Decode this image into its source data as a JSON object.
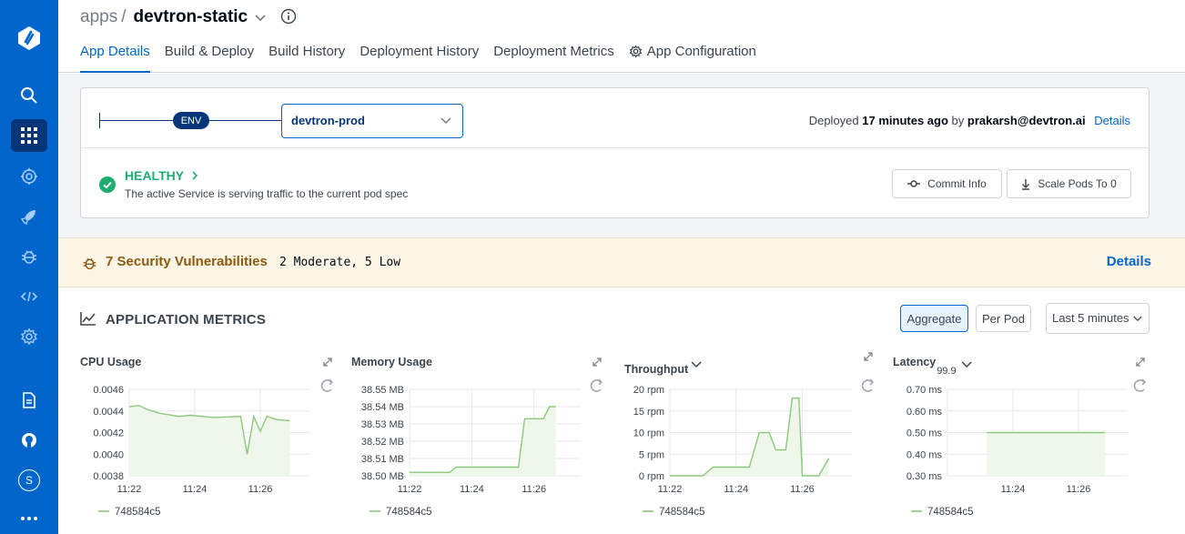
{
  "breadcrumb": {
    "root": "apps",
    "separator": "/",
    "app_name": "devtron-static"
  },
  "tabs": [
    {
      "label": "App Details",
      "active": true
    },
    {
      "label": "Build & Deploy"
    },
    {
      "label": "Build History"
    },
    {
      "label": "Deployment History"
    },
    {
      "label": "Deployment Metrics"
    },
    {
      "label": "App Configuration",
      "icon": "gear-icon"
    }
  ],
  "environment": {
    "pill": "ENV",
    "selected": "devtron-prod"
  },
  "deployment": {
    "prefix": "Deployed",
    "time": "17 minutes ago",
    "by": "by",
    "user": "prakarsh@devtron.ai",
    "details_link": "Details"
  },
  "health": {
    "status": "HEALTHY",
    "description": "The active Service is serving traffic to the current pod spec"
  },
  "actions": {
    "commit_info": "Commit Info",
    "scale_pods": "Scale Pods To 0"
  },
  "security": {
    "title": "7 Security Vulnerabilities",
    "counts": "2 Moderate, 5 Low",
    "details": "Details"
  },
  "metrics": {
    "title": "APPLICATION METRICS",
    "aggregate": "Aggregate",
    "per_pod": "Per Pod",
    "range": "Last 5 minutes",
    "series_color": "#8cc97c",
    "pod": "748584c5"
  },
  "chart_data": [
    {
      "type": "area",
      "title": "CPU Usage",
      "x_ticks": [
        "11:22",
        "11:24",
        "11:26"
      ],
      "y_ticks": [
        "0.0046",
        "0.0044",
        "0.0042",
        "0.0040",
        "0.0038"
      ],
      "ylim": [
        0.0038,
        0.0046
      ],
      "x_range": [
        0,
        5.5
      ],
      "x_tick_pos": [
        0,
        2,
        4
      ],
      "series": [
        {
          "name": "748584c5",
          "x": [
            0,
            0.3,
            0.5,
            0.9,
            1.5,
            1.9,
            2.2,
            2.6,
            3.4,
            3.6,
            3.8,
            4.0,
            4.2,
            4.5,
            4.9
          ],
          "values": [
            0.00444,
            0.00445,
            0.00442,
            0.00438,
            0.00435,
            0.00436,
            0.00435,
            0.00434,
            0.00435,
            0.004,
            0.00435,
            0.00421,
            0.00435,
            0.00432,
            0.00431
          ]
        }
      ],
      "legend": "748584c5"
    },
    {
      "type": "area",
      "title": "Memory Usage",
      "x_ticks": [
        "11:22",
        "11:24",
        "11:26"
      ],
      "y_ticks": [
        "38.55 MB",
        "38.54 MB",
        "38.53 MB",
        "38.52 MB",
        "38.51 MB",
        "38.50 MB"
      ],
      "ylim": [
        38.5,
        38.55
      ],
      "x_range": [
        0,
        5.5
      ],
      "x_tick_pos": [
        0,
        2,
        4
      ],
      "series": [
        {
          "name": "748584c5",
          "x": [
            0,
            1.3,
            1.5,
            3.5,
            3.7,
            4.3,
            4.5,
            4.7
          ],
          "values": [
            38.502,
            38.502,
            38.505,
            38.505,
            38.533,
            38.533,
            38.54,
            38.54
          ]
        }
      ],
      "legend": "748584c5"
    },
    {
      "type": "area",
      "title": "Throughput",
      "x_ticks": [
        "11:22",
        "11:24",
        "11:26"
      ],
      "y_ticks": [
        "20 rpm",
        "15 rpm",
        "10 rpm",
        "5 rpm",
        "0 rpm"
      ],
      "ylim": [
        0,
        20
      ],
      "x_range": [
        0,
        5.5
      ],
      "x_tick_pos": [
        0,
        2,
        4
      ],
      "series": [
        {
          "name": "748584c5",
          "x": [
            0,
            1.0,
            1.3,
            2.4,
            2.7,
            3.0,
            3.2,
            3.5,
            3.7,
            3.9,
            4.0,
            4.3,
            4.5,
            4.8
          ],
          "values": [
            0,
            0,
            2,
            2,
            10,
            10,
            6,
            6,
            18,
            18,
            0,
            0,
            0,
            4
          ]
        }
      ],
      "legend": "748584c5"
    },
    {
      "type": "area",
      "title": "Latency",
      "subtitle": "99.9",
      "x_ticks": [
        "11:24",
        "11:26"
      ],
      "y_ticks": [
        "0.70 ms",
        "0.60 ms",
        "0.50 ms",
        "0.40 ms",
        "0.30 ms"
      ],
      "ylim": [
        0.3,
        0.7
      ],
      "x_range": [
        0,
        5.5
      ],
      "x_tick_pos": [
        2,
        4
      ],
      "series": [
        {
          "name": "748584c5",
          "x": [
            1.2,
            4.8
          ],
          "values": [
            0.5,
            0.5
          ]
        }
      ],
      "legend": "748584c5"
    }
  ],
  "user_initial": "S"
}
